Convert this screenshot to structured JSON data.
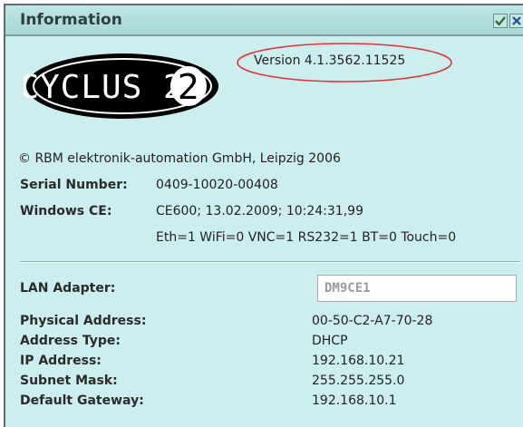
{
  "window": {
    "title": "Information"
  },
  "version_text": "Version 4.1.3562.11525",
  "logo": {
    "text": "CYCLUS 2",
    "icon": "cyclus-logo"
  },
  "copyright": "© RBM elektronik-automation GmbH, Leipzig 2006",
  "serial": {
    "label": "Serial Number:",
    "value": "0409-10020-00408"
  },
  "windows_ce": {
    "label": "Windows CE:",
    "value": "CE600; 13.02.2009; 10:24:31,99",
    "features": "Eth=1 WiFi=0 VNC=1 RS232=1 BT=0 Touch=0"
  },
  "lan_adapter": {
    "label": "LAN Adapter:",
    "value": "DM9CE1"
  },
  "network": [
    {
      "label": "Physical Address:",
      "value": "00-50-C2-A7-70-28"
    },
    {
      "label": "Address Type:",
      "value": "DHCP"
    },
    {
      "label": "IP Address:",
      "value": "192.168.10.21"
    },
    {
      "label": "Subnet Mask:",
      "value": "255.255.255.0"
    },
    {
      "label": "Default Gateway:",
      "value": "192.168.10.1"
    }
  ],
  "colors": {
    "background": "#cdeeee",
    "highlight_ellipse": "#e0333a"
  }
}
